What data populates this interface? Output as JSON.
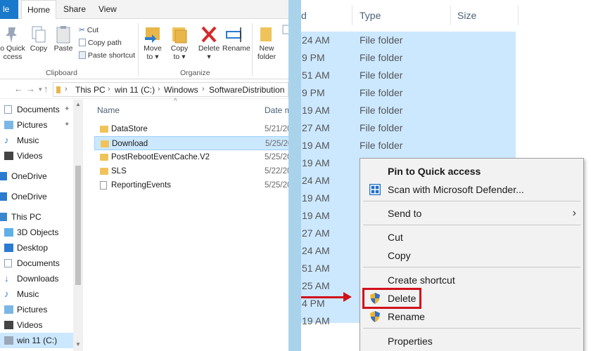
{
  "tabs": {
    "file": "le",
    "home": "Home",
    "share": "Share",
    "view": "View"
  },
  "ribbon": {
    "pin_label_1": "o Quick",
    "pin_label_2": "ccess",
    "copy": "Copy",
    "paste": "Paste",
    "cut": "Cut",
    "copy_path": "Copy path",
    "paste_shortcut": "Paste shortcut",
    "clipboard_group": "Clipboard",
    "move_to_1": "Move",
    "move_to_2": "to",
    "copy_to_1": "Copy",
    "copy_to_2": "to",
    "delete": "Delete",
    "rename": "Rename",
    "organize_group": "Organize",
    "new_folder_1": "New",
    "new_folder_2": "folder"
  },
  "address": {
    "crumbs": [
      "This PC",
      "win 11 (C:)",
      "Windows",
      "SoftwareDistribution"
    ]
  },
  "nav": {
    "items": [
      {
        "label": "Documents",
        "pinned": true
      },
      {
        "label": "Pictures",
        "pinned": true
      },
      {
        "label": "Music"
      },
      {
        "label": "Videos"
      },
      {
        "label": "OneDrive"
      },
      {
        "label": "OneDrive"
      },
      {
        "label": "This PC"
      },
      {
        "label": "3D Objects"
      },
      {
        "label": "Desktop"
      },
      {
        "label": "Documents"
      },
      {
        "label": "Downloads"
      },
      {
        "label": "Music"
      },
      {
        "label": "Pictures"
      },
      {
        "label": "Videos"
      },
      {
        "label": "win 11 (C:)"
      }
    ]
  },
  "filelist": {
    "col_name": "Name",
    "col_date": "Date m",
    "rows": [
      {
        "name": "DataStore",
        "date": "5/21/20"
      },
      {
        "name": "Download",
        "date": "5/25/20"
      },
      {
        "name": "PostRebootEventCache.V2",
        "date": "5/25/20"
      },
      {
        "name": "SLS",
        "date": "5/22/20"
      },
      {
        "name": "ReportingEvents",
        "date": "5/25/20"
      }
    ]
  },
  "right": {
    "col_date_tail": "d",
    "col_type": "Type",
    "col_size": "Size",
    "rows": [
      {
        "time": "24 AM",
        "type": "File folder"
      },
      {
        "time": "9 PM",
        "type": "File folder"
      },
      {
        "time": "51 AM",
        "type": "File folder"
      },
      {
        "time": "9 PM",
        "type": "File folder"
      },
      {
        "time": "19 AM",
        "type": "File folder"
      },
      {
        "time": "27 AM",
        "type": "File folder"
      },
      {
        "time": "19 AM",
        "type": "File folder"
      },
      {
        "time": "19 AM",
        "type": ""
      },
      {
        "time": "24 AM",
        "type": ""
      },
      {
        "time": "19 AM",
        "type": ""
      },
      {
        "time": "19 AM",
        "type": ""
      },
      {
        "time": "27 AM",
        "type": ""
      },
      {
        "time": "24 AM",
        "type": ""
      },
      {
        "time": "51 AM",
        "type": ""
      },
      {
        "time": "25 AM",
        "type": ""
      },
      {
        "time": "4 PM",
        "type": ""
      },
      {
        "time": "19 AM",
        "type": ""
      }
    ]
  },
  "context_menu": {
    "pin": "Pin to Quick access",
    "scan": "Scan with Microsoft Defender...",
    "send_to": "Send to",
    "cut": "Cut",
    "copy": "Copy",
    "create_shortcut": "Create shortcut",
    "delete": "Delete",
    "rename": "Rename",
    "properties": "Properties"
  },
  "colors": {
    "selection": "#cce8ff",
    "highlight_red": "#d1111a",
    "divider": "#a9d3ea",
    "folder": "#e8b64a"
  }
}
